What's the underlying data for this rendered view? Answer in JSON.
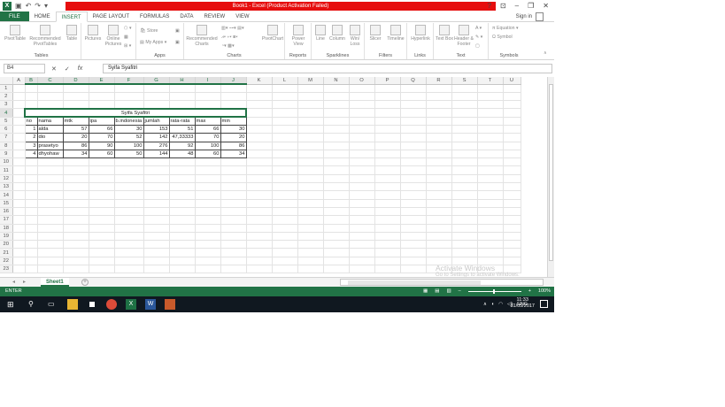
{
  "window": {
    "title": "Book1 - Excel (Product Activation Failed)",
    "help": "?"
  },
  "ribbon_tabs": [
    "FILE",
    "HOME",
    "INSERT",
    "PAGE LAYOUT",
    "FORMULAS",
    "DATA",
    "REVIEW",
    "VIEW"
  ],
  "active_tab": "INSERT",
  "signin": "Sign in",
  "ribbon_groups": {
    "tables": {
      "label": "Tables",
      "buttons": [
        "PivotTable",
        "Recommended PivotTables",
        "Table"
      ]
    },
    "illustrations": {
      "buttons": [
        "Pictures",
        "Online Pictures"
      ]
    },
    "apps": {
      "label": "Apps",
      "store": "Store",
      "myapps": "My Apps"
    },
    "charts": {
      "label": "Charts",
      "recommended": "Recommended Charts",
      "pivotchart": "PivotChart"
    },
    "reports": {
      "label": "Reports",
      "powerview": "Power View"
    },
    "sparklines": {
      "label": "Sparklines",
      "buttons": [
        "Line",
        "Column",
        "Win/ Loss"
      ]
    },
    "filters": {
      "label": "Filters",
      "buttons": [
        "Slicer",
        "Timeline"
      ]
    },
    "links": {
      "label": "Links",
      "buttons": [
        "Hyperlink"
      ]
    },
    "text": {
      "label": "Text",
      "buttons": [
        "Text Box",
        "Header & Footer"
      ]
    },
    "symbols": {
      "label": "Symbols",
      "equation": "Equation",
      "symbol": "Symbol"
    }
  },
  "formula_bar": {
    "name_box": "B4",
    "fx": "fx",
    "content": "Syifa Syafitri"
  },
  "columns": [
    "A",
    "B",
    "C",
    "D",
    "E",
    "F",
    "G",
    "H",
    "I",
    "J",
    "K",
    "L",
    "M",
    "N",
    "O",
    "P",
    "Q",
    "R",
    "S",
    "T",
    "U"
  ],
  "rows": [
    "1",
    "2",
    "3",
    "4",
    "5",
    "6",
    "7",
    "8",
    "9",
    "10",
    "11",
    "12",
    "13",
    "14",
    "15",
    "16",
    "17",
    "18",
    "19",
    "20",
    "21",
    "22",
    "23"
  ],
  "sheet": {
    "title": "Syifa Syafitri",
    "headers": [
      "no",
      "nama",
      "mtk",
      "ipa",
      "b.indonesia",
      "jumlah",
      "rata-rata",
      "max",
      "min"
    ],
    "data": [
      [
        "1",
        "alda",
        "57",
        "66",
        "30",
        "153",
        "51",
        "66",
        "30"
      ],
      [
        "2",
        "dio",
        "20",
        "70",
        "52",
        "142",
        "47,33333",
        "70",
        "20"
      ],
      [
        "3",
        "prasetyo",
        "86",
        "90",
        "100",
        "276",
        "92",
        "100",
        "86"
      ],
      [
        "4",
        "dhyohaw",
        "34",
        "60",
        "50",
        "144",
        "48",
        "60",
        "34"
      ]
    ]
  },
  "sheet_tab": "Sheet1",
  "statusbar": {
    "mode": "ENTER",
    "zoom": "100%"
  },
  "watermark": {
    "line1": "Activate Windows",
    "line2": "Go to Settings to activate Windows."
  },
  "taskbar": {
    "lang": "ENG",
    "time": "11:33",
    "date": "31/05/2017"
  }
}
